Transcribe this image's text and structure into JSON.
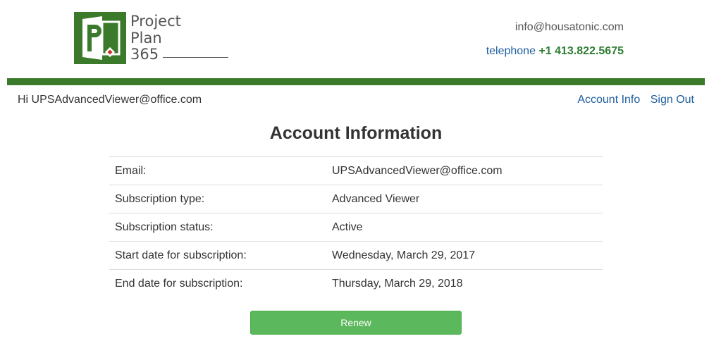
{
  "logo": {
    "line1": "Project",
    "line2": "Plan",
    "line3": "365",
    "brand_color": "#2e7d32"
  },
  "contact": {
    "email": "info@housatonic.com",
    "phone_label": "telephone",
    "phone_number": "+1 413.822.5675"
  },
  "greeting": "Hi UPSAdvancedViewer@office.com",
  "nav": {
    "account_info": "Account Info",
    "sign_out": "Sign Out"
  },
  "title": "Account Information",
  "account_rows": [
    {
      "label": "Email:",
      "value": "UPSAdvancedViewer@office.com"
    },
    {
      "label": "Subscription type:",
      "value": "Advanced Viewer"
    },
    {
      "label": "Subscription status:",
      "value": "Active"
    },
    {
      "label": "Start date for subscription:",
      "value": "Wednesday, March 29, 2017"
    },
    {
      "label": "End date for subscription:",
      "value": "Thursday, March 29, 2018"
    }
  ],
  "renew_label": "Renew",
  "colors": {
    "header_bar": "#3b7a2b",
    "link": "#1f5fa0",
    "button": "#5cb85c"
  }
}
